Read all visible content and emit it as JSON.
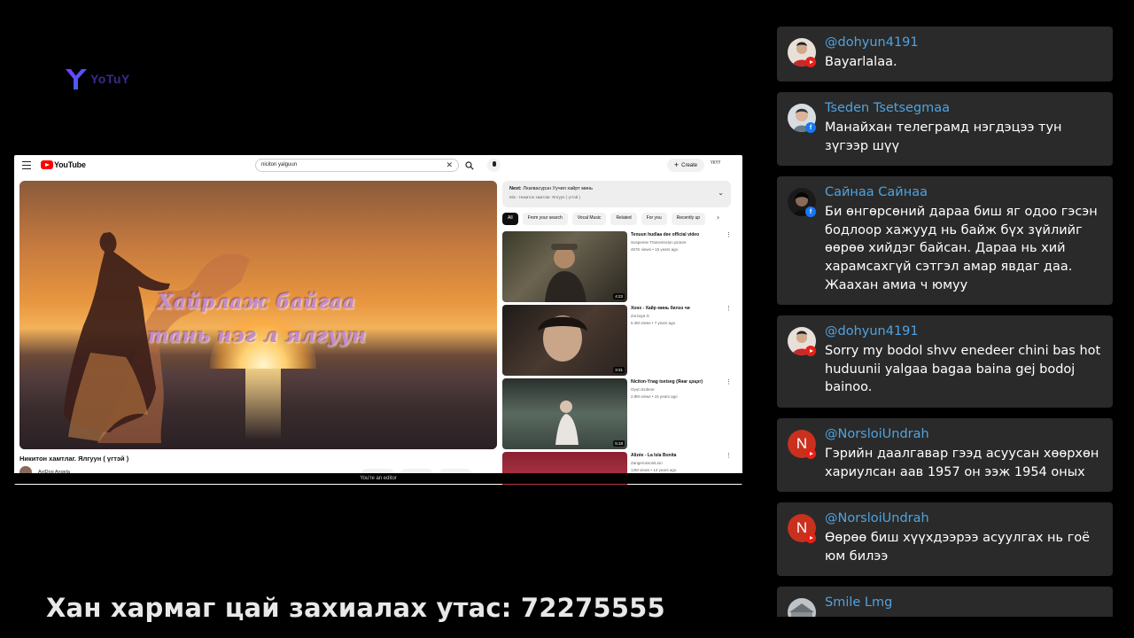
{
  "channel_logo": {
    "icon": "y-logo-icon",
    "text": "YoTuY"
  },
  "shared_screen": {
    "menu_icon": "hamburger-icon",
    "logo_text": "YouTube",
    "search": {
      "value": "niciton yalguun",
      "clear_icon": "close-icon",
      "search_icon": "search-icon",
      "mic_icon": "mic-icon"
    },
    "create_label": "Create",
    "account_label": "ҮКҮҮ",
    "video": {
      "lyric_line1": "Хайрлаж байгаа",
      "lyric_line2": "тань нэг л ялгуун",
      "title": "Никитон хамтлаг. Ялгуун ( үгтэй )",
      "channel": "AyiDog Angela"
    },
    "next_panel": {
      "label": "Next:",
      "next_title": "Лхагвасүрэн Уучил хайрт минь",
      "mix_text": "Mix - Никитон хамтлаг. Ялгуун ( үгтэй )"
    },
    "chips": [
      "All",
      "From your search",
      "Vocal Music",
      "Related",
      "For you",
      "Recently up"
    ],
    "recommendations": [
      {
        "title": "Tenuun hudlaa dee official video",
        "channel": "Suspense Transmission picture",
        "meta": "457K views • 15 years ago",
        "duration": "4:23"
      },
      {
        "title": "Хонх - Хайр минь билээ чи",
        "channel": "Zorzaya G",
        "meta": "5.3M views • 7 years ago",
        "duration": "3:31"
      },
      {
        "title": "Niciton-Ynag tsetseg (Янаг цэцэг)",
        "channel": "Oyun Erdene",
        "meta": "2.8M views • 15 years ago",
        "duration": "5:18"
      },
      {
        "title": "Alizée - La Isla Bonita",
        "channel": "ZangerossoniLion",
        "meta": "13M views • 14 years ago",
        "duration": ""
      }
    ],
    "editor_notice": "You're an editor"
  },
  "promo_text": "Хан хармаг цай захиалах утас: 72275555",
  "comments": [
    {
      "author": "@dohyun4191",
      "text": "Bayarlalaa.",
      "platform": "youtube"
    },
    {
      "author": "Tseden Tsetsegmaa",
      "text": "Манайхан телеграмд нэгдэцээ тун зүгээр шүү",
      "platform": "facebook"
    },
    {
      "author": "Сайнаа Сайнаа",
      "text": "Би өнгөрсөний дараа биш яг одоо гэсэн бодлоор хажууд нь байж бүх зүйлийг өөрөө хийдэг байсан. Дараа нь хий харамсахгүй сэтгэл амар явдаг даа. Жаахан амиа ч юмуу",
      "platform": "facebook"
    },
    {
      "author": "@dohyun4191",
      "text": "Sorry my bodol shvv enedeer chini bas hot huduunii yalgaa bagaa baina gej bodoj bainoo.",
      "platform": "youtube"
    },
    {
      "author": "@NorsloiUndrah",
      "text": "Гэрийн даалгавар гээд асуусан хөөрхөн хариулсан аав 1957 он ээж 1954 оных",
      "platform": "youtube",
      "avatar_letter": "N"
    },
    {
      "author": "@NorsloiUndrah",
      "text": "Өөрөө биш хүүхдээрээ асуулгах нь гоё юм билээ",
      "platform": "youtube",
      "avatar_letter": "N"
    },
    {
      "author": "Smile Lmg",
      "text": "",
      "platform": "facebook"
    }
  ],
  "colors": {
    "author_link": "#4fa3e0",
    "comment_bg": "#2a2a2a",
    "youtube_red": "#e62117",
    "facebook_blue": "#1877f2"
  }
}
